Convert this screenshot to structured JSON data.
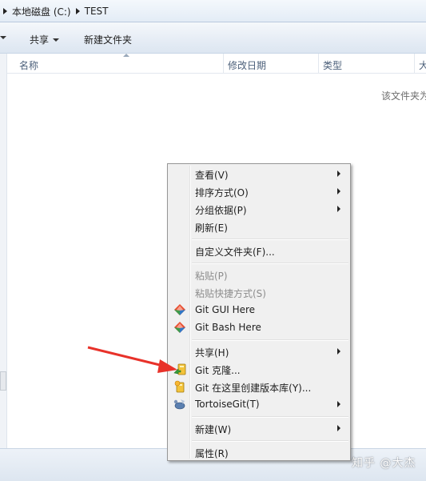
{
  "address_bar": {
    "crumbs": [
      "本地磁盘 (C:)",
      "TEST"
    ]
  },
  "toolbar": {
    "share_label": "共享",
    "new_folder_label": "新建文件夹"
  },
  "columns": {
    "name": "名称",
    "modified": "修改日期",
    "type": "类型",
    "size": "大"
  },
  "file_list": {
    "empty_message": "该文件夹为"
  },
  "context_menu": {
    "view": "查看(V)",
    "sort_by": "排序方式(O)",
    "group_by": "分组依据(P)",
    "refresh": "刷新(E)",
    "customize": "自定义文件夹(F)...",
    "paste": "粘贴(P)",
    "paste_shortcut": "粘贴快捷方式(S)",
    "git_gui": "Git GUI Here",
    "git_bash": "Git Bash Here",
    "share": "共享(H)",
    "git_clone": "Git 克隆...",
    "git_create_repo": "Git 在这里创建版本库(Y)...",
    "tortoisegit": "TortoiseGit(T)",
    "new": "新建(W)",
    "properties": "属性(R)"
  },
  "watermark": "知乎 @大杰",
  "colors": {
    "annotation_arrow": "#e8322a",
    "menu_bg": "#f0f0f0",
    "toolbar_top": "#f5f8fb"
  }
}
